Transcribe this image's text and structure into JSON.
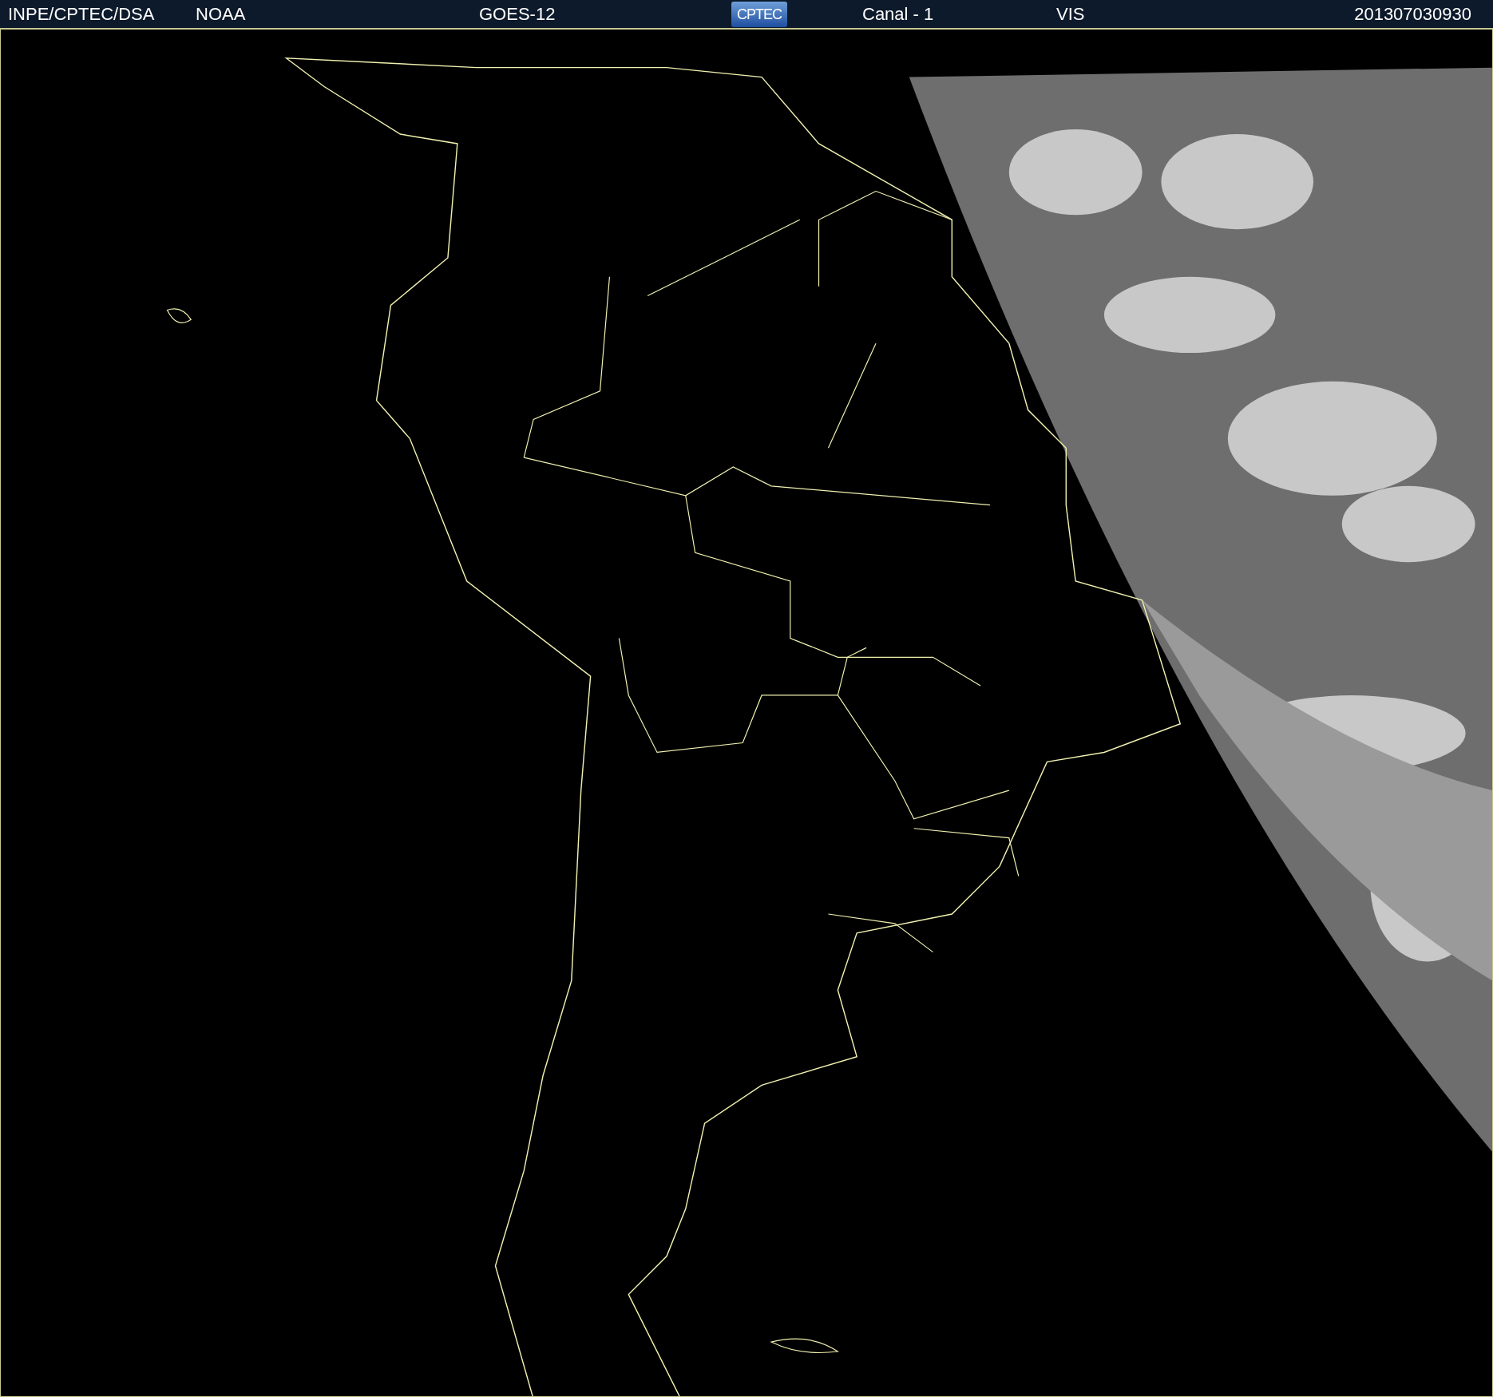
{
  "header": {
    "agency": "INPE/CPTEC/DSA",
    "source": "NOAA",
    "satellite": "GOES-12",
    "logo": "CPTEC",
    "channel": "Canal - 1",
    "band": "VIS",
    "timestamp": "201307030930"
  }
}
